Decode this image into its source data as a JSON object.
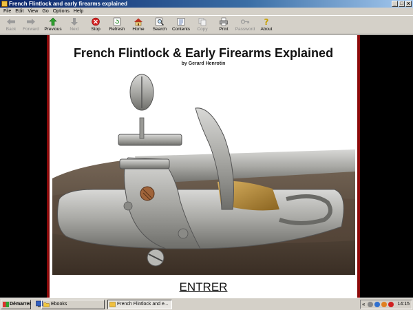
{
  "window": {
    "title": "French Flintlock and early firearms explained",
    "controls": {
      "minimize": "_",
      "maximize": "□",
      "close": "x"
    }
  },
  "menu": [
    "File",
    "Edit",
    "View",
    "Go",
    "Options",
    "Help"
  ],
  "toolbar": [
    {
      "label": "Back",
      "icon": "back-arrow-icon",
      "enabled": false
    },
    {
      "label": "Forward",
      "icon": "forward-arrow-icon",
      "enabled": false
    },
    {
      "label": "Previous",
      "icon": "previous-arrow-icon",
      "enabled": true
    },
    {
      "label": "Next",
      "icon": "next-arrow-icon",
      "enabled": false
    },
    {
      "label": "Stop",
      "icon": "stop-icon",
      "enabled": true
    },
    {
      "label": "Refresh",
      "icon": "refresh-icon",
      "enabled": true
    },
    {
      "label": "Home",
      "icon": "home-icon",
      "enabled": true
    },
    {
      "label": "Search",
      "icon": "search-icon",
      "enabled": true
    },
    {
      "label": "Contents",
      "icon": "contents-icon",
      "enabled": true
    },
    {
      "label": "Copy",
      "icon": "copy-icon",
      "enabled": false
    },
    {
      "label": "Print",
      "icon": "print-icon",
      "enabled": true
    },
    {
      "label": "Password",
      "icon": "password-key-icon",
      "enabled": false
    },
    {
      "label": "About",
      "icon": "about-icon",
      "enabled": true
    }
  ],
  "page": {
    "title": "French Flintlock & Early Firearms Explained",
    "byline": "by Gerard Henrotin",
    "enter": "ENTRER"
  },
  "taskbar": {
    "start": "Démarrer",
    "tasks": [
      {
        "label": "Ebooks",
        "active": false
      },
      {
        "label": "French Flintlock and e...",
        "active": true
      }
    ],
    "tray_expand": "«",
    "clock": "14:15"
  }
}
